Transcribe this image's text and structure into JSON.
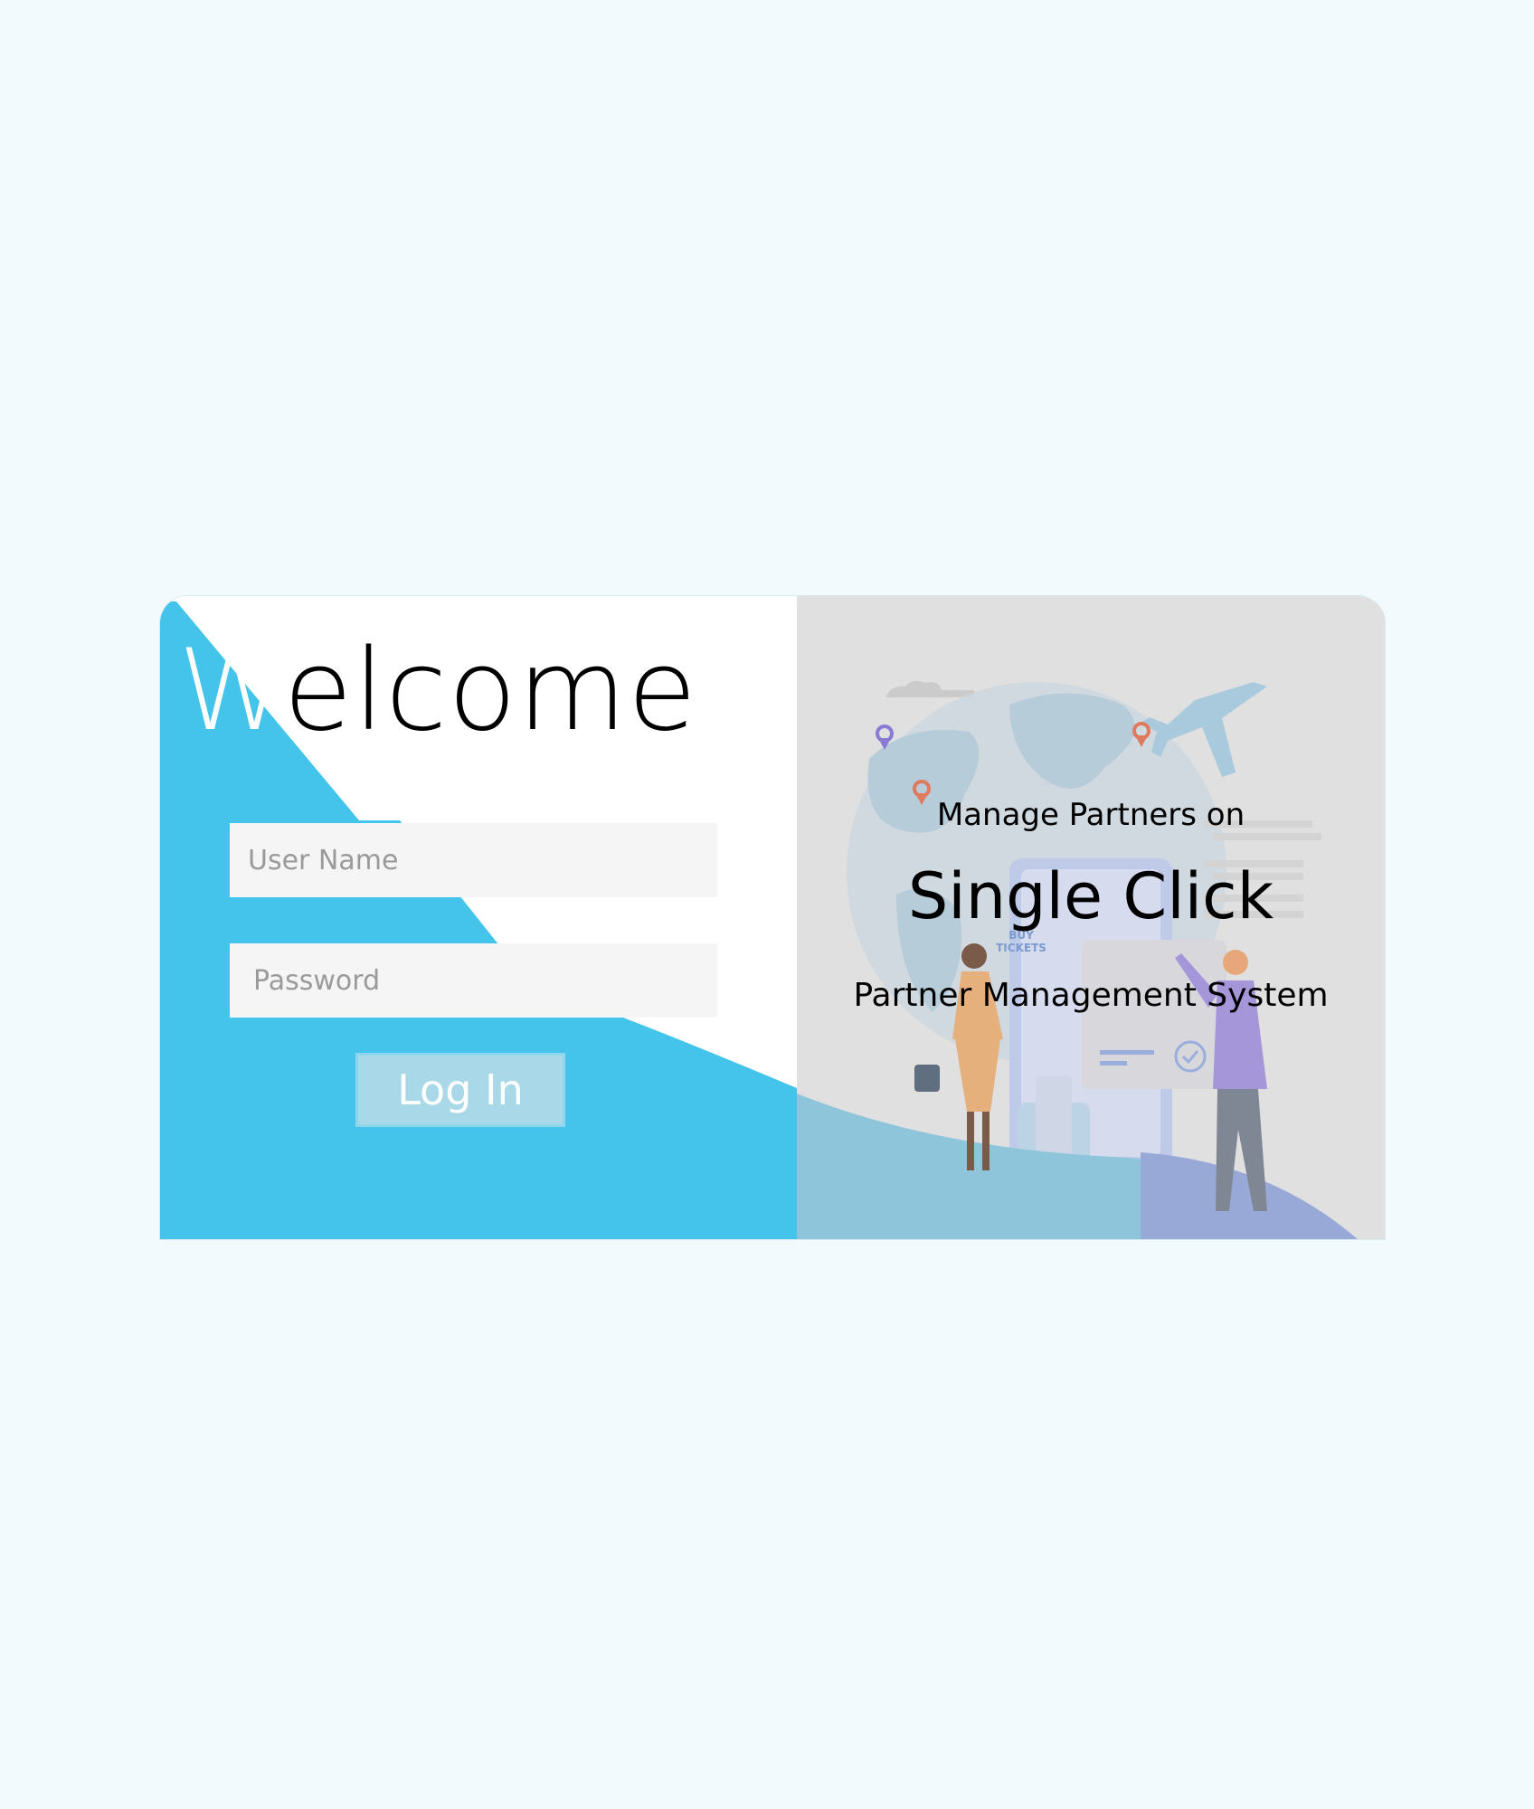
{
  "login": {
    "welcome_first": "W",
    "welcome_rest": "elcome",
    "username_placeholder": "User Name",
    "password_placeholder": "Password",
    "submit_label": "Log In"
  },
  "promo": {
    "line1": "Manage Partners on",
    "line2": "Single Click",
    "line3": "Partner Management System",
    "illustration_label_1": "BUY",
    "illustration_label_2": "TICKETS"
  },
  "colors": {
    "page_background": "#f2fafd",
    "accent_blue": "#44c4ea",
    "panel_gray": "#e0e0e0",
    "input_background": "#f5f5f5",
    "button_background": "#a9d9e8"
  }
}
